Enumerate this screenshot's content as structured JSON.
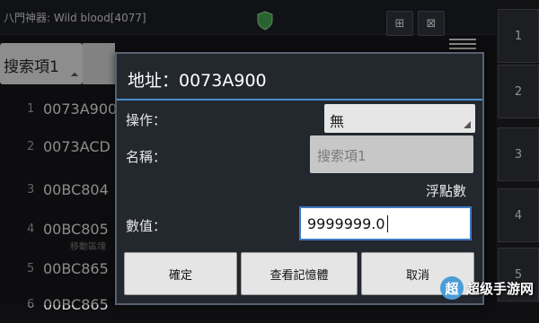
{
  "app": {
    "title": "八門神器: Wild blood[4077]",
    "search_chip": "搜索項1",
    "top_buttons": [
      "⊞",
      "⊠"
    ],
    "list": [
      {
        "index": "1",
        "addr": "0073A900",
        "sub": ""
      },
      {
        "index": "2",
        "addr": "0073ACD",
        "sub": ""
      },
      {
        "index": "3",
        "addr": "00BC804",
        "sub": ""
      },
      {
        "index": "4",
        "addr": "00BC805",
        "sub": "移動區塊"
      },
      {
        "index": "5",
        "addr": "00BC865",
        "sub": ""
      },
      {
        "index": "6",
        "addr": "00BC865",
        "sub": ""
      }
    ],
    "num_buttons": [
      "1",
      "2",
      "3",
      "4",
      "5"
    ]
  },
  "dialog": {
    "title": "地址：0073A900",
    "operation_label": "操作：",
    "operation_value": "無",
    "name_label": "名稱：",
    "name_placeholder": "搜索項1",
    "type_label": "浮點數",
    "value_label": "數值：",
    "value": "9999999.0",
    "buttons": {
      "confirm": "確定",
      "view_memory": "查看記憶體",
      "cancel": "取消"
    }
  },
  "watermark": {
    "logo": "超",
    "text": "超级手游网"
  },
  "colors": {
    "dialog_bg": "#23272e",
    "accent": "#4b8fd0",
    "field": "#e6e6e6"
  }
}
